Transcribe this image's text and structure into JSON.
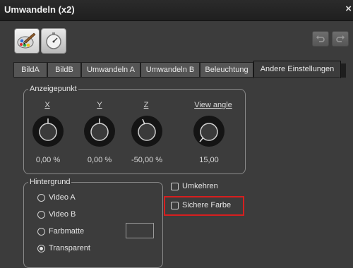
{
  "window": {
    "title": "Umwandeln (x2)",
    "close_glyph": "×"
  },
  "toolbar": {
    "left_buttons": [
      {
        "icon": "palette-brush-icon"
      },
      {
        "icon": "stopwatch-icon"
      }
    ],
    "right_buttons": [
      {
        "icon": "undo-icon"
      },
      {
        "icon": "redo-icon"
      }
    ]
  },
  "tabs": [
    {
      "label": "BildA",
      "active": false
    },
    {
      "label": "BildB",
      "active": false
    },
    {
      "label": "Umwandeln A",
      "active": false
    },
    {
      "label": "Umwandeln B",
      "active": false
    },
    {
      "label": "Beleuchtung",
      "active": false
    },
    {
      "label": "Andere Einstellungen",
      "active": true
    }
  ],
  "anzeigepunkt": {
    "label": "Anzeigepunkt",
    "knobs": [
      {
        "label": "X",
        "value": "0,00 %"
      },
      {
        "label": "Y",
        "value": "0,00 %"
      },
      {
        "label": "Z",
        "value": "-50,00 %"
      },
      {
        "label": "View angle",
        "value": "15,00"
      }
    ]
  },
  "hintergrund": {
    "label": "Hintergrund",
    "options": [
      {
        "label": "Video A",
        "selected": false
      },
      {
        "label": "Video B",
        "selected": false
      },
      {
        "label": "Farbmatte",
        "selected": false
      },
      {
        "label": "Transparent",
        "selected": true
      }
    ]
  },
  "checkboxes": [
    {
      "label": "Umkehren",
      "checked": false
    },
    {
      "label": "Sichere Farbe",
      "checked": false
    }
  ],
  "colors": {
    "highlight": "#d61f1f",
    "background": "#3c3c3c"
  }
}
